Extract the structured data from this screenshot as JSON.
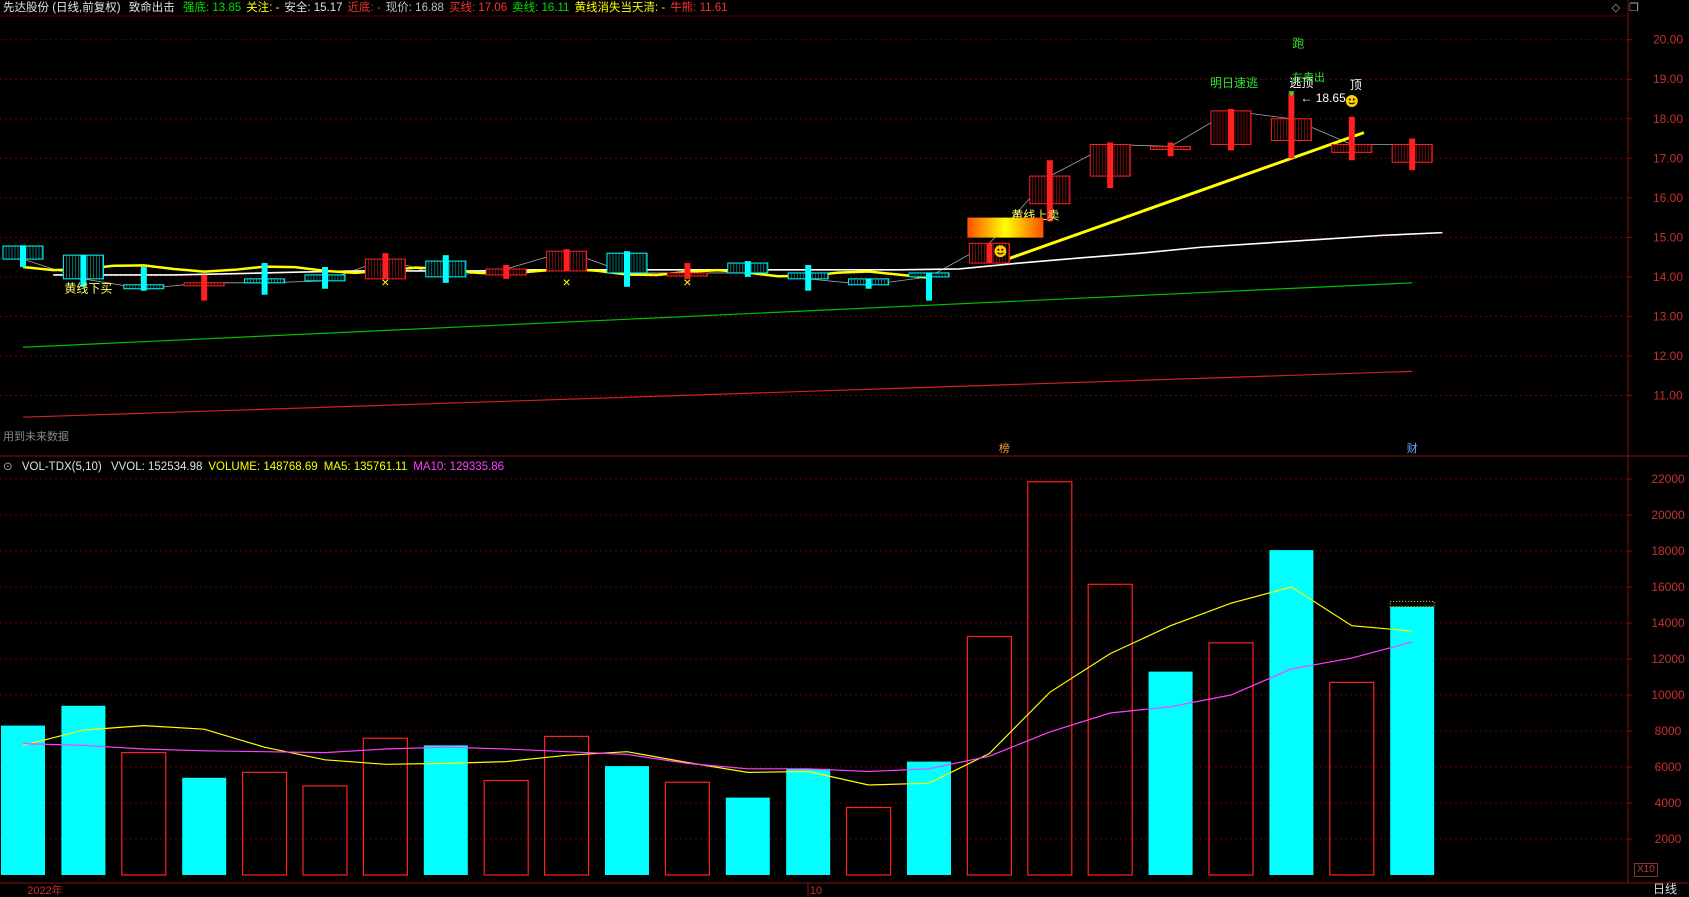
{
  "header": {
    "stock_name": "先达股份 (日线,前复权)",
    "indicator_name": "致命出击",
    "items": [
      {
        "label": "强底:",
        "value": "13.85",
        "color": "#00e000"
      },
      {
        "label": "关注:",
        "value": "-",
        "color": "#ffff00"
      },
      {
        "label": "安全:",
        "value": "15.17",
        "color": "#e0e0e0"
      },
      {
        "label": "近底:",
        "value": "-",
        "color": "#ff3030"
      },
      {
        "label": "现价:",
        "value": "16.88",
        "color": "#c0c0c0"
      },
      {
        "label": "买线:",
        "value": "17.06",
        "color": "#ff3030"
      },
      {
        "label": "卖线:",
        "value": "16.11",
        "color": "#00e000"
      },
      {
        "label": "黄线消失当天清:",
        "value": "-",
        "color": "#ffff00"
      },
      {
        "label": "牛熊:",
        "value": "11.61",
        "color": "#ff3030"
      }
    ]
  },
  "volume_header": {
    "title": "VOL-TDX(5,10)",
    "items": [
      {
        "label": "VVOL:",
        "value": "152534.98",
        "color": "#e0e0e0"
      },
      {
        "label": "VOLUME:",
        "value": "148768.69",
        "color": "#ffff00"
      },
      {
        "label": "MA5:",
        "value": "135761.11",
        "color": "#ffff00"
      },
      {
        "label": "MA10:",
        "value": "129335.86",
        "color": "#ff40ff"
      }
    ]
  },
  "window_icons": [
    "diamond-icon",
    "restore-icon"
  ],
  "notes": {
    "future_data": "用到未来数据",
    "bang": "榜",
    "cai": "财",
    "run": "跑",
    "tomorrow_escape": "明日速逃",
    "escape_top": "逃顶",
    "sell_left": "左卖出",
    "top": "顶",
    "peak_price": "18.65",
    "yellow_up_sell": "黄线上卖",
    "yellow_down_buy": "黄线下买"
  },
  "footer": {
    "year_label": "2022年",
    "month_label": "10",
    "period": "日线",
    "zoom": "X10"
  },
  "colors": {
    "up": "#ff2020",
    "down": "#00ffff",
    "ma_white": "#ffffff",
    "green_line": "#00c000",
    "red_line": "#d02020",
    "yellow_line": "#ffff00",
    "grid": "#6a0000",
    "magenta": "#ff40ff"
  },
  "chart_data": [
    {
      "type": "candlestick",
      "title": "先达股份 (日线,前复权)",
      "y_axis_ticks": [
        "20.00",
        "19.00",
        "18.00",
        "17.00",
        "16.00",
        "15.00",
        "14.00",
        "13.00",
        "12.00",
        "11.00"
      ],
      "ylim": [
        10.0,
        20.6
      ],
      "candles": [
        {
          "o": 14.78,
          "h": 14.8,
          "l": 14.25,
          "c": 14.45
        },
        {
          "o": 14.55,
          "h": 14.55,
          "l": 13.75,
          "c": 13.95
        },
        {
          "o": 13.8,
          "h": 14.25,
          "l": 13.65,
          "c": 13.7
        },
        {
          "o": 13.8,
          "h": 14.05,
          "l": 13.4,
          "c": 13.85
        },
        {
          "o": 13.95,
          "h": 14.35,
          "l": 13.55,
          "c": 13.85
        },
        {
          "o": 14.05,
          "h": 14.25,
          "l": 13.7,
          "c": 13.9
        },
        {
          "o": 13.95,
          "h": 14.6,
          "l": 13.95,
          "c": 14.45
        },
        {
          "o": 14.4,
          "h": 14.55,
          "l": 13.85,
          "c": 14.0
        },
        {
          "o": 14.05,
          "h": 14.3,
          "l": 13.95,
          "c": 14.2
        },
        {
          "o": 14.15,
          "h": 14.7,
          "l": 14.15,
          "c": 14.65
        },
        {
          "o": 14.6,
          "h": 14.65,
          "l": 13.75,
          "c": 14.1
        },
        {
          "o": 14.1,
          "h": 14.35,
          "l": 13.95,
          "c": 14.1
        },
        {
          "o": 14.35,
          "h": 14.4,
          "l": 14.0,
          "c": 14.1
        },
        {
          "o": 14.1,
          "h": 14.3,
          "l": 13.65,
          "c": 13.95
        },
        {
          "o": 13.95,
          "h": 13.95,
          "l": 13.7,
          "c": 13.8
        },
        {
          "o": 14.1,
          "h": 14.1,
          "l": 13.4,
          "c": 14.0
        },
        {
          "o": 14.35,
          "h": 14.85,
          "l": 14.35,
          "c": 14.85
        },
        {
          "o": 15.85,
          "h": 16.95,
          "l": 15.4,
          "c": 16.55
        },
        {
          "o": 16.55,
          "h": 17.4,
          "l": 16.25,
          "c": 17.35
        },
        {
          "o": 17.25,
          "h": 17.4,
          "l": 17.05,
          "c": 17.3
        },
        {
          "o": 17.35,
          "h": 18.25,
          "l": 17.2,
          "c": 18.2
        },
        {
          "o": 17.45,
          "h": 18.65,
          "l": 17.0,
          "c": 18.0
        },
        {
          "o": 17.15,
          "h": 18.05,
          "l": 16.95,
          "c": 17.35
        },
        {
          "o": 16.9,
          "h": 17.5,
          "l": 16.7,
          "c": 17.35
        }
      ],
      "ma_white": [
        null,
        14.05,
        14.05,
        14.05,
        14.08,
        14.12,
        14.15,
        14.15,
        14.15,
        14.18,
        14.18,
        14.18,
        14.18,
        14.18,
        14.18,
        14.18,
        14.2,
        14.35,
        14.48,
        14.6,
        14.75,
        14.85,
        14.95,
        15.05,
        15.12
      ],
      "green_line": [
        12.22,
        13.85
      ],
      "red_line": [
        10.45,
        11.61
      ],
      "yellow_segments": [
        {
          "from": [
            0,
            14.25
          ],
          "to": [
            15,
            14.05
          ],
          "style": "wavy"
        },
        {
          "from": [
            16.3,
            14.45
          ],
          "to": [
            22.2,
            17.65
          ],
          "style": "thick"
        }
      ]
    },
    {
      "type": "bar",
      "title": "VOL-TDX(5,10)",
      "y_axis_ticks": [
        "22000",
        "20000",
        "18000",
        "16000",
        "14000",
        "12000",
        "10000",
        "8000",
        "6000",
        "4000",
        "2000"
      ],
      "ylim": [
        0,
        22500
      ],
      "values": [
        8300,
        9400,
        6800,
        5400,
        5700,
        4950,
        7600,
        7200,
        5250,
        7700,
        6050,
        5150,
        4300,
        5900,
        3750,
        6300,
        13250,
        21850,
        16150,
        11300,
        12900,
        18050,
        10700,
        14900
      ],
      "down": [
        true,
        true,
        false,
        true,
        false,
        false,
        false,
        true,
        false,
        false,
        true,
        false,
        true,
        true,
        false,
        true,
        false,
        false,
        false,
        true,
        false,
        true,
        false,
        true
      ],
      "ma5": [
        7200,
        8050,
        8300,
        8100,
        7100,
        6400,
        6150,
        6200,
        6300,
        6650,
        6850,
        6250,
        5700,
        5750,
        5000,
        5100,
        6750,
        10150,
        12300,
        13850,
        15100,
        16000,
        13850,
        13550
      ],
      "ma10": [
        7300,
        7200,
        7000,
        6900,
        6850,
        6800,
        7000,
        7100,
        7000,
        6850,
        6700,
        6200,
        5900,
        5900,
        5750,
        5900,
        6600,
        7950,
        9000,
        9350,
        10000,
        11450,
        12050,
        12950
      ]
    }
  ]
}
